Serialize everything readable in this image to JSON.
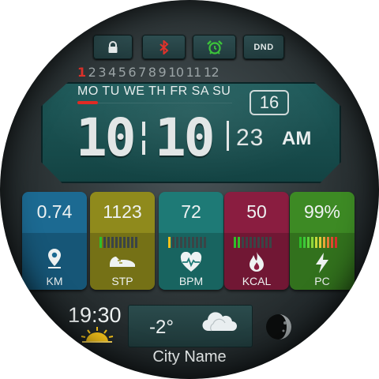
{
  "status": {
    "dnd_label": "DND",
    "icons": [
      "lock-icon",
      "bluetooth-icon",
      "alarm-icon"
    ],
    "colors": {
      "lock": "#e8eeee",
      "bluetooth": "#e0322b",
      "alarm": "#3cc43a"
    }
  },
  "months": [
    "1",
    "2",
    "3",
    "4",
    "5",
    "6",
    "7",
    "8",
    "9",
    "10",
    "11",
    "12"
  ],
  "active_month": "1",
  "days": "MO TU WE TH FR SA SU",
  "date": "16",
  "time": {
    "hours": "10",
    "minutes": "10",
    "seconds": "23",
    "ampm": "AM"
  },
  "tiles": [
    {
      "value": "0.74",
      "unit": "KM",
      "icon": "location-pin-icon",
      "color": "#1c6a92",
      "level": null
    },
    {
      "value": "1123",
      "unit": "STP",
      "icon": "sneaker-icon",
      "color": "#8f8a1c",
      "level": 0.1
    },
    {
      "value": "72",
      "unit": "BPM",
      "icon": "heart-pulse-icon",
      "color": "#1e7a76",
      "level": 0.1
    },
    {
      "value": "50",
      "unit": "KCAL",
      "icon": "flame-icon",
      "color": "#8a1d40",
      "level": 0.2
    },
    {
      "value": "99%",
      "unit": "PC",
      "icon": "lightning-icon",
      "color": "#3d8a24",
      "level": 0.99
    }
  ],
  "bottom": {
    "time": "19:30",
    "temperature": "-2°",
    "city": "City Name",
    "icons": [
      "sunset-icon",
      "cloud-icon",
      "moon-icon"
    ]
  }
}
